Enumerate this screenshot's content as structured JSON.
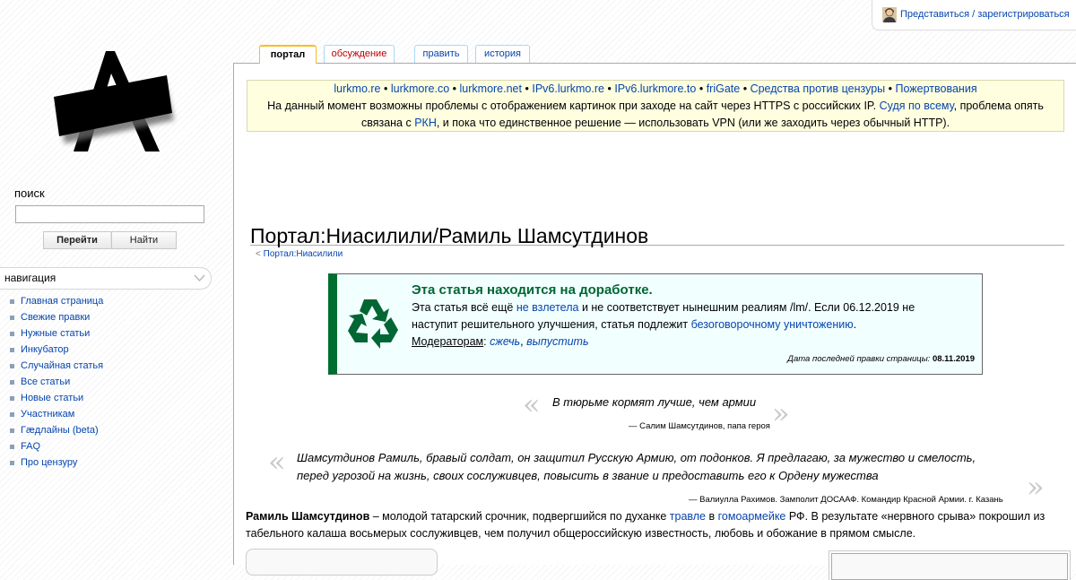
{
  "userbar": {
    "login_label": "Представиться / зарегистрироваться",
    "icon": "user-icon"
  },
  "logo": {
    "icon": "lurkmore-logo"
  },
  "search": {
    "heading": "поиск",
    "value": "",
    "go_label": "Перейти",
    "find_label": "Найти"
  },
  "navigation": {
    "heading": "навигация",
    "items": [
      {
        "label": "Главная страница"
      },
      {
        "label": "Свежие правки"
      },
      {
        "label": "Нужные статьи"
      },
      {
        "label": "Инкубатор"
      },
      {
        "label": "Случайная статья"
      },
      {
        "label": "Все статьи"
      },
      {
        "label": "Новые статьи"
      },
      {
        "label": "Участникам"
      },
      {
        "label": "Гæдлайны (beta)"
      },
      {
        "label": "FAQ"
      },
      {
        "label": "Про цензуру"
      }
    ]
  },
  "tabs": {
    "portal": "портал",
    "discussion": "обсуждение",
    "edit": "править",
    "history": "история"
  },
  "sitenotice": {
    "links": [
      "lurkmo.re",
      "lurkmore.co",
      "lurkmore.net",
      "IPv6.lurkmo.re",
      "IPv6.lurkmore.to",
      "friGate",
      "Средства против цензуры",
      "Пожертвования"
    ],
    "separator": "•",
    "line2_text": "На данный момент возможны проблемы с отображением картинок при заходе на сайт через HTTPS с российских IP.",
    "line2_link": "Судя по всему",
    "line2_tail": ", проблема опять",
    "line3_head": "связана с",
    "line3_link": "РКН",
    "line3_tail": ", и пока что единственное решение — использовать VPN (или же заходить через обычный HTTP)."
  },
  "page": {
    "title": "Портал:Ниасилили/Рамиль Шамсутдинов",
    "breadcrumb_prefix": "<",
    "breadcrumb_link": "Портал:Ниасилили"
  },
  "rework": {
    "icon": "recycle-icon",
    "title": "Эта статья находится на доработке.",
    "text_1": "Эта статья всё ещё",
    "link_1": "не взлетела",
    "text_2": "и не соответствует нынешним реалиям /lm/. Если 06.12.2019 не наступит решительного улучшения, статья подлежит",
    "link_2": "безоговорочному уничтожению",
    "text_3": ".",
    "moderators_label": "Модераторам",
    "colon": ":",
    "action_burn": "сжечь",
    "comma": ",",
    "action_release": "выпустить",
    "date_label": "Дата последней правки страницы:",
    "date_value": "08.11.2019",
    "accent_color": "#006e2e"
  },
  "quotes": [
    {
      "text": "В тюрьме кормят лучше, чем армии",
      "author": "— Салим Шамсутдинов, папа героя"
    },
    {
      "text": "Шамсутдинов Рамиль, бравый солдат, он защитил Русскую Армию, от подонков. Я предлагаю, за мужество и смелость, перед угрозой на жизнь, своих сослуживцев, повысить в звание и предоставить его к Ордену мужества",
      "author": "— Валиулла Рахимов. Замполит ДОСААФ. Командир Красной Армии. г. Казань"
    }
  ],
  "quote_marks": {
    "open": "«",
    "close": "»"
  },
  "lead": {
    "bold_name": "Рамиль Шамсутдинов",
    "text_1": " – молодой татарский срочник, подвергшийся по духанке ",
    "link_1": "травле",
    "text_2": " в ",
    "link_2": "гомоармейке",
    "text_3": " РФ. В результате «нервного срыва» покрошил из табельного калаша восьмерых сослуживцев, чем получил общероссийскую известность, любовь и обожание в прямом смысле."
  }
}
